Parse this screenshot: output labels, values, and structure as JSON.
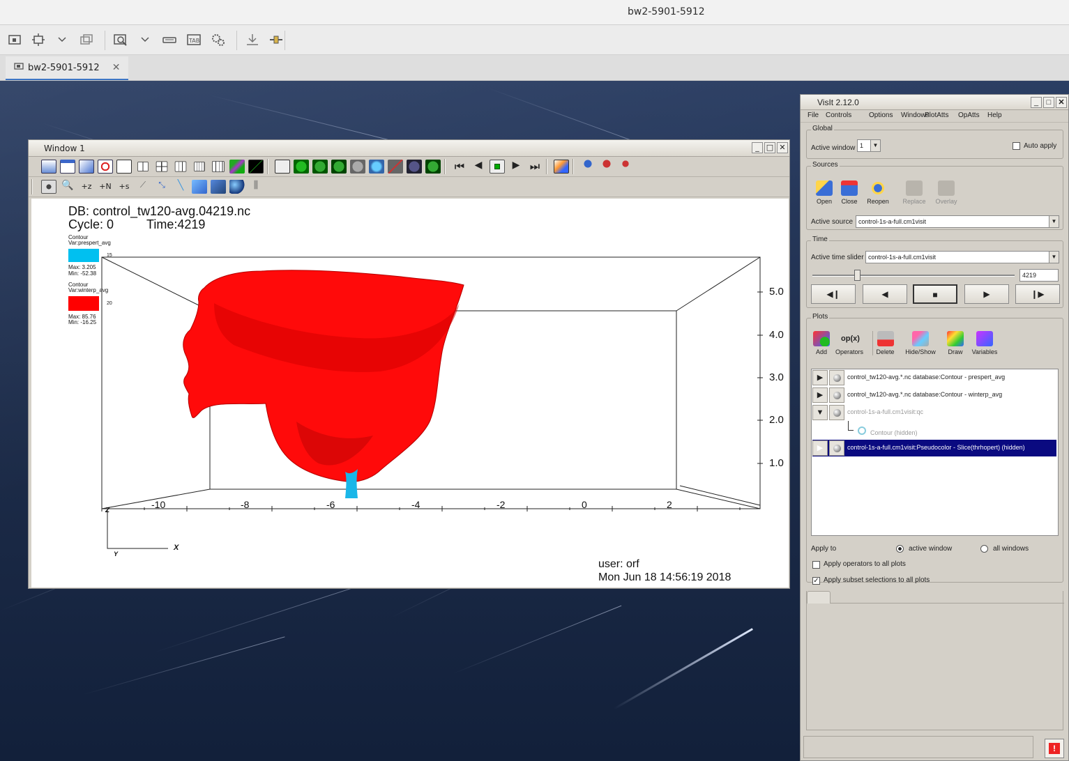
{
  "host": {
    "window_title": "bw2-5901-5912",
    "tab_label": "bw2-5901-5912"
  },
  "viewer": {
    "window_title": "Window 1",
    "db_line": "DB: control_tw120-avg.04219.nc",
    "cycle_line": "Cycle: 0",
    "time_line": "Time:4219",
    "legends": [
      {
        "plot": "Contour",
        "var": "Var:prespert_avg",
        "color": "#00c0f0",
        "level": "15",
        "max": "Max: 3.205",
        "min": "Min: -52.38"
      },
      {
        "plot": "Contour",
        "var": "Var:winterp_avg",
        "color": "#ff0000",
        "level": "20",
        "max": "Max: 85.76",
        "min": "Min: -16.25"
      }
    ],
    "x_ticks": [
      "-10",
      "-8",
      "-6",
      "-4",
      "-2",
      "0",
      "2"
    ],
    "z_ticks": [
      "5.0",
      "4.0",
      "3.0",
      "2.0",
      "1.0"
    ],
    "triad": {
      "z": "Z",
      "x": "X",
      "y": "Y"
    },
    "user_line": "user: orf",
    "date_line": "Mon Jun 18 14:56:19 2018"
  },
  "gui": {
    "title": "VisIt 2.12.0",
    "menu": [
      "File",
      "Controls",
      "Options",
      "Windows",
      "PlotAtts",
      "OpAtts",
      "Help"
    ],
    "global": {
      "group_title": "Global",
      "active_window_label": "Active window",
      "active_window_value": "1",
      "auto_apply_label": "Auto apply"
    },
    "sources": {
      "group_title": "Sources",
      "buttons": [
        "Open",
        "Close",
        "Reopen",
        "Replace",
        "Overlay"
      ],
      "active_source_label": "Active source",
      "active_source_value": "control-1s-a-full.cm1visit"
    },
    "time": {
      "group_title": "Time",
      "slider_label": "Active time slider",
      "slider_value": "control-1s-a-full.cm1visit",
      "state_value": "4219",
      "slider_fraction": 0.22
    },
    "plots": {
      "group_title": "Plots",
      "buttons": [
        "Add",
        "Operators",
        "Delete",
        "Hide/Show",
        "Draw",
        "Variables"
      ],
      "list": [
        {
          "label": "control_tw120-avg.*.nc database:Contour - prespert_avg",
          "expand": "▶",
          "dim": false,
          "selected": false
        },
        {
          "label": "control_tw120-avg.*.nc database:Contour - winterp_avg",
          "expand": "▶",
          "dim": false,
          "selected": false
        },
        {
          "label": "control-1s-a-full.cm1visit:qc",
          "expand": "▼",
          "dim": true,
          "selected": false
        },
        {
          "label": "control-1s-a-full.cm1visit:Pseudocolor - Slice(thrhopert) (hidden)",
          "expand": "▶",
          "dim": false,
          "selected": true
        }
      ],
      "sub_item": "Contour (hidden)",
      "apply_to_label": "Apply to",
      "apply_active": "active window",
      "apply_all": "all windows",
      "apply_operators": "Apply operators to all plots",
      "apply_subsets": "Apply subset selections to all plots"
    }
  }
}
